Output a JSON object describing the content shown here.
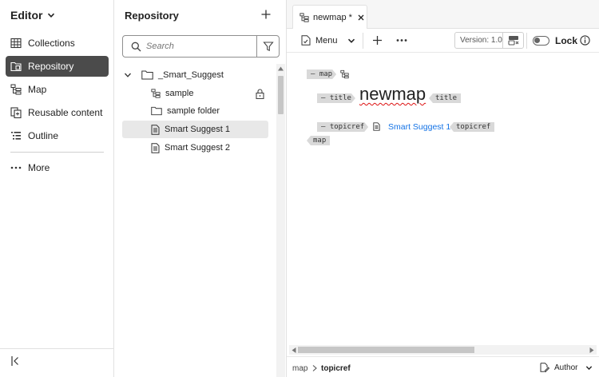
{
  "left_nav": {
    "header": "Editor",
    "items": [
      {
        "label": "Collections",
        "icon": "collections-icon"
      },
      {
        "label": "Repository",
        "icon": "repository-icon",
        "active": true
      },
      {
        "label": "Map",
        "icon": "map-icon"
      },
      {
        "label": "Reusable content",
        "icon": "reusable-content-icon"
      },
      {
        "label": "Outline",
        "icon": "outline-icon"
      }
    ],
    "more_label": "More"
  },
  "repository": {
    "title": "Repository",
    "search_placeholder": "Search",
    "tree": [
      {
        "label": "_Smart_Suggest",
        "type": "folder",
        "expanded": true
      },
      {
        "label": "sample",
        "type": "map",
        "locked": true
      },
      {
        "label": "sample folder",
        "type": "folder"
      },
      {
        "label": "Smart Suggest 1",
        "type": "topic",
        "selected": true
      },
      {
        "label": "Smart Suggest 2",
        "type": "topic"
      }
    ]
  },
  "editor": {
    "tab": {
      "label": "newmap *"
    },
    "toolbar": {
      "menu_label": "Menu",
      "version_label": "Version: 1.0",
      "lock_label": "Lock",
      "lock_on": false
    },
    "content": {
      "map_start_tag": "map",
      "title_start_tag": "title",
      "title_text": "newmap",
      "title_end_tag": "title",
      "topicref_start_tag": "topicref",
      "topicref_link": "Smart Suggest 1",
      "topicref_end_tag": "topicref",
      "map_end_tag": "map"
    },
    "status": {
      "breadcrumb": [
        "map",
        "topicref"
      ],
      "mode_label": "Author"
    }
  },
  "colors": {
    "active_nav_bg": "#4b4b4b",
    "link": "#1473e6",
    "tag_bg": "#d9d9d9",
    "selected_row_bg": "#e8e8e8"
  }
}
